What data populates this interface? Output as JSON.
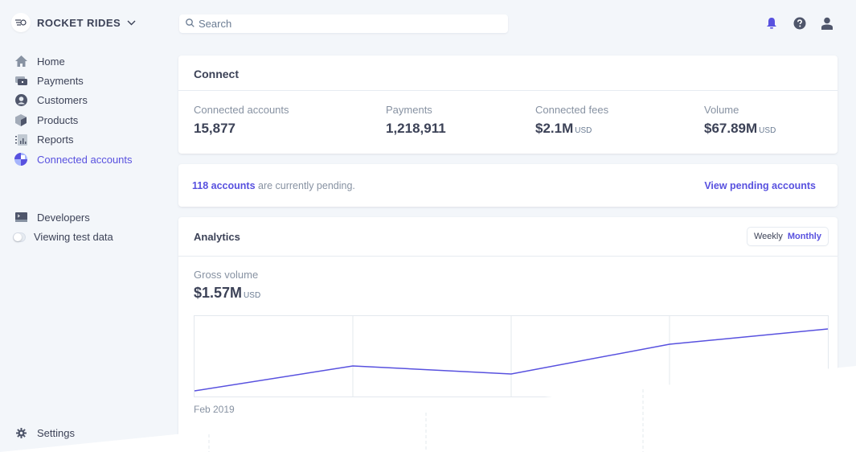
{
  "brand": {
    "name": "ROCKET RIDES"
  },
  "search": {
    "placeholder": "Search"
  },
  "sidebar": {
    "items": [
      {
        "label": "Home",
        "icon": "home-icon"
      },
      {
        "label": "Payments",
        "icon": "payments-icon"
      },
      {
        "label": "Customers",
        "icon": "customers-icon"
      },
      {
        "label": "Products",
        "icon": "products-icon"
      },
      {
        "label": "Reports",
        "icon": "reports-icon"
      },
      {
        "label": "Connected accounts",
        "icon": "connected-accounts-icon",
        "active": true
      }
    ],
    "secondary": [
      {
        "label": "Developers",
        "icon": "terminal-icon"
      },
      {
        "label": "Viewing test data",
        "icon": "toggle-switch"
      }
    ],
    "settings": {
      "label": "Settings",
      "icon": "gear-icon"
    }
  },
  "topbar": {
    "icons": [
      "bell-icon",
      "help-icon",
      "user-icon"
    ]
  },
  "connect": {
    "title": "Connect",
    "stats": [
      {
        "label": "Connected accounts",
        "value": "15,877",
        "unit": ""
      },
      {
        "label": "Payments",
        "value": "1,218,911",
        "unit": ""
      },
      {
        "label": "Connected fees",
        "value": "$2.1M",
        "unit": "USD"
      },
      {
        "label": "Volume",
        "value": "$67.89M",
        "unit": "USD"
      }
    ]
  },
  "pending": {
    "count_link": "118 accounts",
    "text": " are currently pending.",
    "action": "View pending accounts"
  },
  "analytics": {
    "title": "Analytics",
    "toggle": {
      "weekly": "Weekly",
      "monthly": "Monthly",
      "selected": "Monthly"
    },
    "metric_label": "Gross volume",
    "metric_value": "$1.57M",
    "metric_unit": "USD"
  },
  "colors": {
    "accent": "#5851df",
    "text": "#3c4257",
    "muted": "#8792a2",
    "background": "#f3f6fa"
  },
  "chart_data": {
    "type": "line",
    "title": "Gross volume",
    "x": [
      1,
      2,
      3,
      4,
      5
    ],
    "x_tick_labels": [
      "Feb 2019"
    ],
    "series": [
      {
        "name": "Gross volume",
        "values": [
          7,
          38,
          28,
          65,
          84
        ]
      }
    ],
    "ylim": [
      0,
      100
    ],
    "grid": true,
    "values_note": "relative scale (percent of plot height); no y-axis labels shown"
  }
}
